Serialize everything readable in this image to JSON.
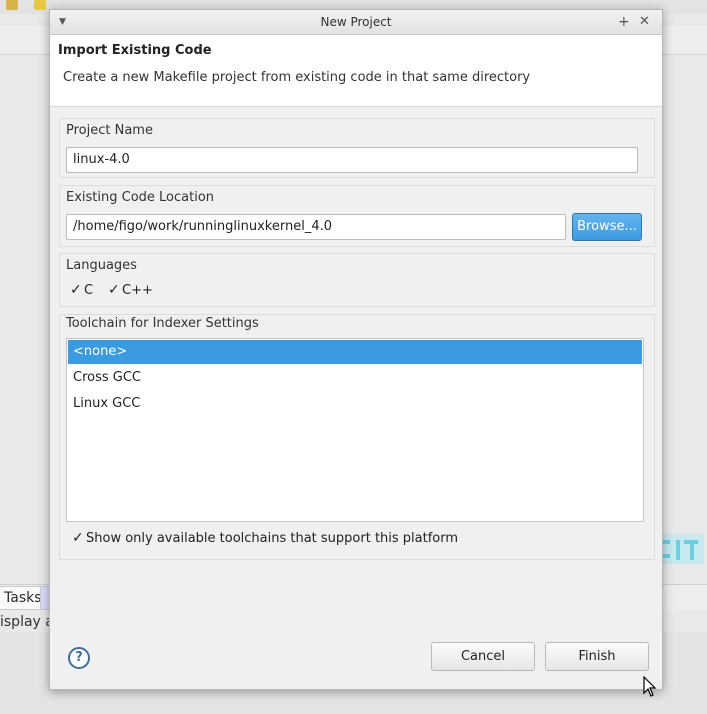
{
  "background": {
    "tab_tasks": "Tasks",
    "status_fragment": "isplay a"
  },
  "dialog": {
    "title": "New Project",
    "header_title": "Import Existing Code",
    "header_description": "Create a new Makefile project from existing code in that same directory",
    "project_name": {
      "label": "Project Name",
      "value": "linux-4.0"
    },
    "code_location": {
      "label": "Existing Code Location",
      "value": "/home/figo/work/runninglinuxkernel_4.0",
      "browse_label": "Browse..."
    },
    "languages": {
      "label": "Languages",
      "options": [
        {
          "label": "C",
          "checked": true
        },
        {
          "label": "C++",
          "checked": true
        }
      ]
    },
    "toolchain": {
      "label": "Toolchain for Indexer Settings",
      "items": [
        "<none>",
        "Cross GCC",
        "Linux GCC"
      ],
      "selected": "<none>",
      "show_only_label": "Show only available toolchains that support this platform",
      "show_only_checked": true
    },
    "cancel_label": "Cancel",
    "finish_label": "Finish"
  },
  "colors": {
    "accent": "#3b9be2",
    "browse": "#4aa6e8"
  },
  "icons": [
    "menu-chevron-icon",
    "maximize-icon",
    "close-icon",
    "checkmark-icon",
    "help-icon",
    "mouse-cursor-icon"
  ]
}
